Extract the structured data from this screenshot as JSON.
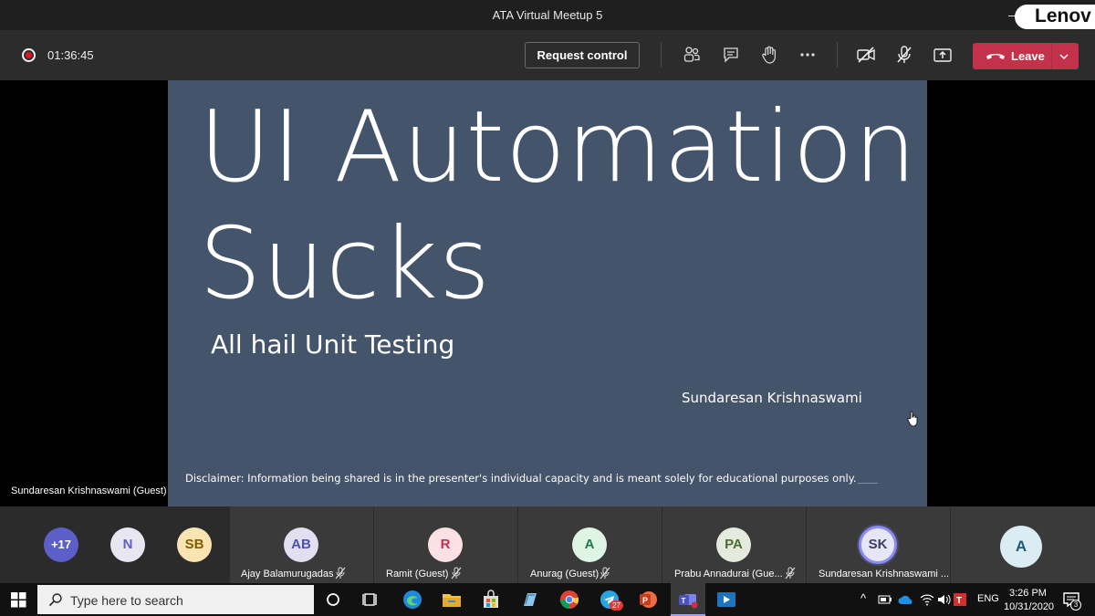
{
  "window": {
    "title": "ATA Virtual Meetup 5",
    "brand": "Lenov"
  },
  "controls": {
    "timer": "01:36:45",
    "request_control": "Request control",
    "leave": "Leave",
    "leave_color": "#c4314b",
    "icons": [
      "participants-icon",
      "chat-icon",
      "raise-hand-icon",
      "more-options-icon",
      "camera-off-icon",
      "mic-off-icon",
      "share-tray-icon"
    ]
  },
  "slide": {
    "title_line1": "UI Automation",
    "title_line2": "Sucks",
    "subtitle": "All hail Unit Testing",
    "author": "Sundaresan Krishnaswami",
    "disclaimer": "Disclaimer: Information being shared is in the presenter's  individual capacity and is meant solely for educational purposes only.",
    "background": "#44546a"
  },
  "presenter_label": "Sundaresan Krishnaswami (Guest)",
  "participants": {
    "overflow": "+17",
    "small": [
      {
        "initials": "N",
        "color": "#e8e6f0",
        "text_color": "#5b5fc7"
      },
      {
        "initials": "SB",
        "color": "#fbe4b2",
        "text_color": "#835b00"
      }
    ],
    "tiles": [
      {
        "initials": "AB",
        "name": "Ajay Balamurugadas",
        "color": "#e1dff0",
        "text_color": "#4f52b2"
      },
      {
        "initials": "R",
        "name": "Ramit (Guest)",
        "color": "#fbe1e6",
        "text_color": "#c4314b"
      },
      {
        "initials": "A",
        "name": "Anurag (Guest)",
        "color": "#def5e6",
        "text_color": "#237b4b"
      },
      {
        "initials": "PA",
        "name": "Prabu Annadurai (Gue...",
        "color": "#e4ebde",
        "text_color": "#4b6d2e"
      },
      {
        "initials": "SK",
        "name": "Sundaresan Krishnaswami ...",
        "color": "#e6e6f5",
        "text_color": "#3d3e66"
      },
      {
        "initials": "A",
        "name": "",
        "color": "#dcecf3",
        "text_color": "#1f5a77"
      }
    ]
  },
  "taskbar": {
    "search_placeholder": "Type here to search",
    "telegram_badge": "27",
    "language": "ENG",
    "time": "3:26 PM",
    "date": "10/31/2020",
    "notifications": "3"
  }
}
